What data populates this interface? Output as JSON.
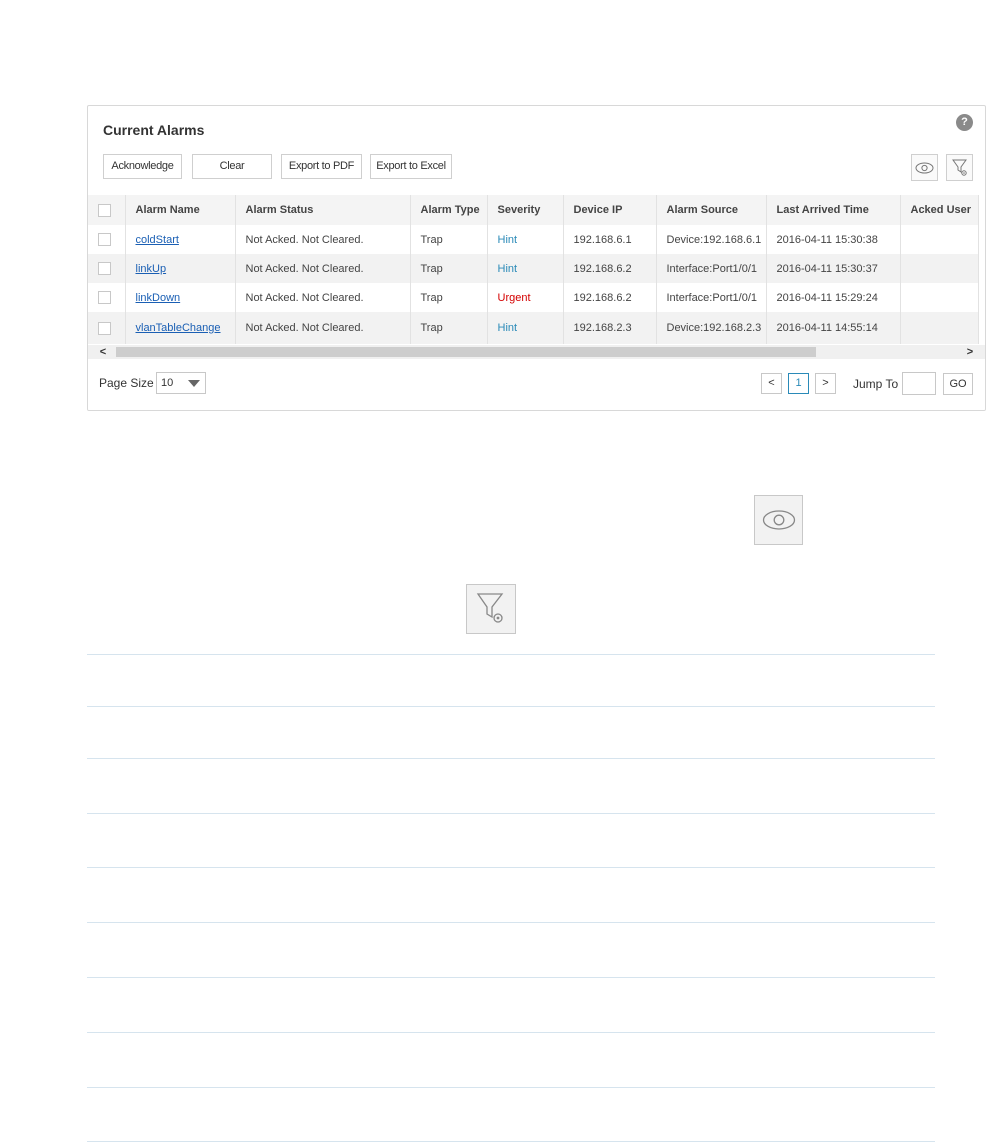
{
  "panel": {
    "title": "Current Alarms",
    "help_glyph": "?",
    "help_icon": "help-circle-icon",
    "eye_icon": "eye-icon",
    "filter_icon": "filter-settings-icon"
  },
  "toolbar": {
    "acknowledge": "Acknowledge",
    "clear": "Clear",
    "export_pdf": "Export to PDF",
    "export_excel": "Export to Excel"
  },
  "table": {
    "columns": [
      "Alarm Name",
      "Alarm Status",
      "Alarm Type",
      "Severity",
      "Device IP",
      "Alarm Source",
      "Last Arrived Time",
      "Acked User"
    ],
    "rows": [
      {
        "name": "coldStart",
        "status": "Not Acked. Not Cleared.",
        "type": "Trap",
        "severity": "Hint",
        "ip": "192.168.6.1",
        "source": "Device:192.168.6.1",
        "time": "2016-04-11 15:30:38",
        "user": ""
      },
      {
        "name": "linkUp",
        "status": "Not Acked. Not Cleared.",
        "type": "Trap",
        "severity": "Hint",
        "ip": "192.168.6.2",
        "source": "Interface:Port1/0/1",
        "time": "2016-04-11 15:30:37",
        "user": ""
      },
      {
        "name": "linkDown",
        "status": "Not Acked. Not Cleared.",
        "type": "Trap",
        "severity": "Urgent",
        "ip": "192.168.6.2",
        "source": "Interface:Port1/0/1",
        "time": "2016-04-11 15:29:24",
        "user": ""
      },
      {
        "name": "vlanTableChange",
        "status": "Not Acked. Not Cleared.",
        "type": "Trap",
        "severity": "Hint",
        "ip": "192.168.2.3",
        "source": "Device:192.168.2.3",
        "time": "2016-04-11 14:55:14",
        "user": ""
      }
    ],
    "severity_colors": {
      "Hint": "#2a8ab8",
      "Urgent": "#d40000"
    }
  },
  "scroll": {
    "left": "<",
    "right": ">"
  },
  "pagination": {
    "page_size_label": "Page Size",
    "page_size_value": "10",
    "prev": "<",
    "current": "1",
    "next": ">",
    "jump_label": "Jump To",
    "go": "GO"
  }
}
